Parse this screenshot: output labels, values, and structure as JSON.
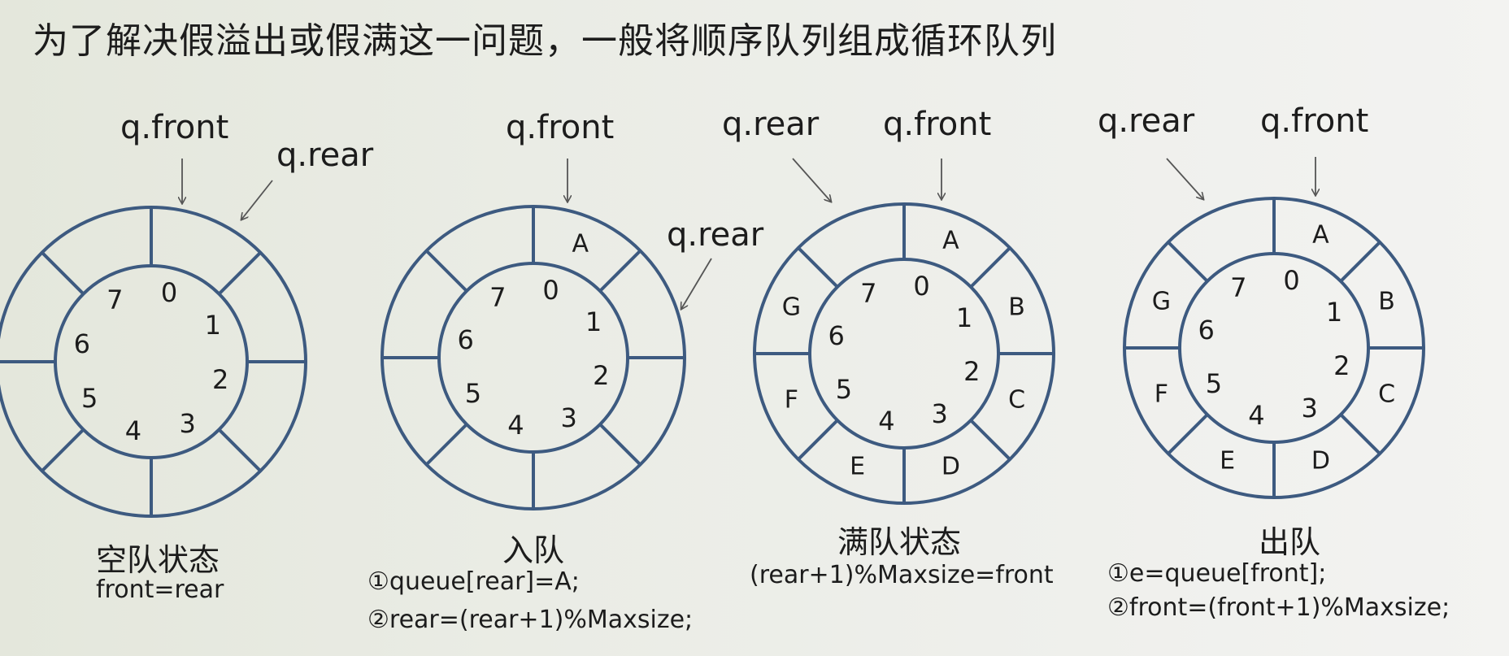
{
  "title": "为了解决假溢出或假满这一问题，一般将顺序队列组成循环队列",
  "ring_style": {
    "stroke": "#3d5a80"
  },
  "pointer_labels": {
    "front": "q.front",
    "rear": "q.rear"
  },
  "index_labels": [
    "0",
    "1",
    "2",
    "3",
    "4",
    "5",
    "6",
    "7"
  ],
  "diagrams": [
    {
      "caption": "空队状态",
      "lines": [
        "front=rear"
      ],
      "slots": [
        "",
        "",
        "",
        "",
        "",
        "",
        "",
        ""
      ]
    },
    {
      "caption": "入队",
      "lines": [
        "①queue[rear]=A;",
        "②rear=(rear+1)%Maxsize;"
      ],
      "slots": [
        "A",
        "",
        "",
        "",
        "",
        "",
        "",
        ""
      ]
    },
    {
      "caption": "满队状态",
      "lines": [
        "(rear+1)%Maxsize=front"
      ],
      "slots": [
        "A",
        "B",
        "C",
        "D",
        "E",
        "F",
        "G",
        ""
      ]
    },
    {
      "caption": "出队",
      "lines": [
        "①e=queue[front];",
        "②front=(front+1)%Maxsize;"
      ],
      "slots": [
        "A",
        "B",
        "C",
        "D",
        "E",
        "F",
        "G",
        ""
      ]
    }
  ]
}
